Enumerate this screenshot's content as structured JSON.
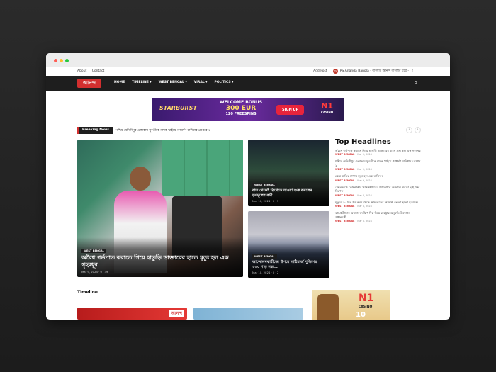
{
  "topbar": {
    "about": "About",
    "contact": "Contact",
    "add_post": "Add Post",
    "ps_brand": "PS Ananda Bangla - বাংলার আনন্দ বাংলার ঘরে -"
  },
  "nav": {
    "logo": "আনন্দ",
    "items": [
      "HOME",
      "TIMELINE ▾",
      "WEST BENGAL ▾",
      "VIRAL ▾",
      "POLITICS ▾"
    ]
  },
  "ad_banner": {
    "brand": "STARBURST",
    "line1": "WELCOME BONUS",
    "line2": "300 EUR",
    "line3": "120 FREESPINS",
    "cta": "SIGN UP",
    "casino_big": "N1",
    "casino_small": "CASINO"
  },
  "breaking": {
    "label": "Breaking News",
    "text": "পশ্চিম মেদিনীপুর এলাকায় যুবতীকে মাদক খাইয়ে গণধর্ষণ যাদিধার গ্রেপ্তার ২"
  },
  "featured": {
    "category": "WEST BENGAL",
    "title": "অবৈধ গর্ভপাত করাতে গিয়ে হাতুড়ি ডাক্তারের হাতে মৃত্যু হল এক গৃহবধূর",
    "meta": "Mar 9, 2024 · 0 · 39"
  },
  "mid_cards": [
    {
      "category": "WEST BENGAL",
      "title": "রাত থেকেই ব্রিগেডে যাওয়া শুরু করলেন তৃণমূলের কর্মী ...",
      "meta": "Mar 10, 2024 · 0 · 3"
    },
    {
      "category": "WEST BENGAL",
      "title": "আন্দোলনকারীদের উপরে লাঠিচার্জ পুলিশের ২০০ পাড় সন্ধ...",
      "meta": "Mar 10, 2024 · 0 · 2"
    }
  ],
  "top_headlines": {
    "title": "Top Headlines",
    "items": [
      {
        "text": "অবৈধ গর্ভপাত করাতে গিয়ে হাতুড়ি ডাক্তারের হাতে মৃত্যু হল এক গৃহবধূর",
        "category": "WEST BENGAL",
        "date": "Mar 9, 2024"
      },
      {
        "text": "পশ্চিম মেদিনীপুর এলাকায় যুবতীকে মাদক খাইয়ে গণধর্ষণ যাদিধার গ্রেপ্তার ২",
        "category": "WEST BENGAL",
        "date": "Mar 9, 2024"
      },
      {
        "text": "ক্ষেত্র যাতির মাথায় মৃত্যু হল এক ব্যক্তির।",
        "category": "WEST BENGAL",
        "date": "Mar 9, 2024"
      },
      {
        "text": "রেশনকার্ডে কোম্পানীর চিনিউইটারের প্যাকেটনে অজান্তে গুড়ো ছাই ঢক্কা নিঃশব্দ",
        "category": "WEST BENGAL",
        "date": "Mar 8, 2024"
      },
      {
        "text": "মৃত্যুর ১০ দিন পর কবর থেকে আদালতের নির্দেশে তোলা হলো মৃতদেহ।",
        "category": "WEST BENGAL",
        "date": "Mar 8, 2024"
      },
      {
        "text": "বহু প্রতীক্ষার অবসান। দক্ষিণ দিক দিয়ে মেট্রোর অনুমতি উদ্বোধন প্রধানমন্ত্রী",
        "category": "WEST BENGAL",
        "date": "Mar 6, 2024"
      }
    ]
  },
  "timeline": {
    "heading": "Timeline",
    "thumb1_logo": "আনন্দ"
  },
  "side_ad": {
    "big": "N1",
    "small": "CASINO",
    "amount": "10"
  }
}
